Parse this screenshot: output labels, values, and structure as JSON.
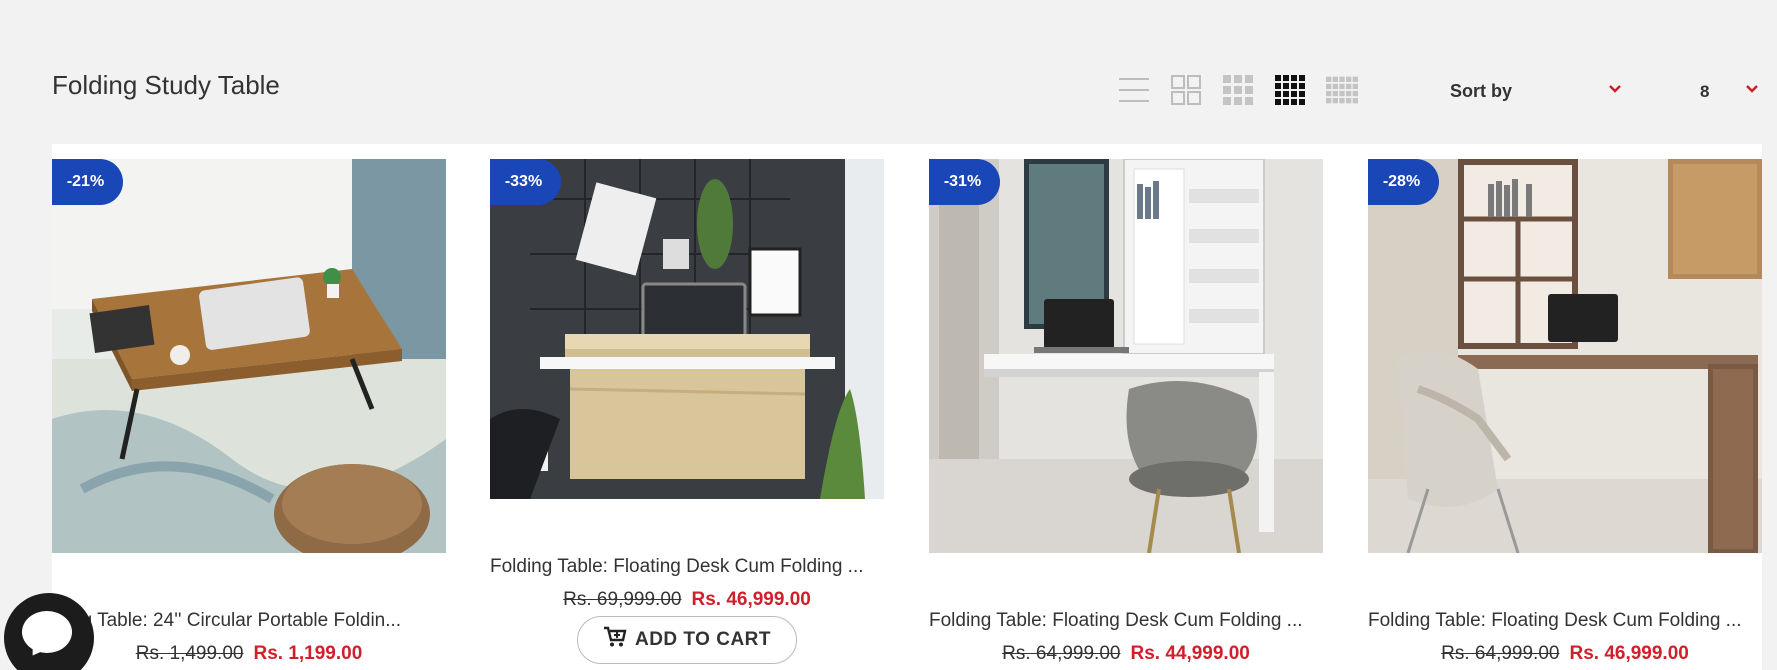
{
  "page": {
    "title": "Folding Study Table"
  },
  "toolbar": {
    "views": [
      "list-view-icon",
      "grid-2-icon",
      "grid-3-icon",
      "grid-4-icon",
      "grid-5-icon"
    ],
    "active_view": "grid-4-icon",
    "sort_label": "Sort by",
    "per_page": "8"
  },
  "colors": {
    "badge": "#1947b8",
    "price_new": "#d0202b",
    "accent": "#c8202a"
  },
  "products": [
    {
      "badge": "-21%",
      "title": "Folding Table: 24'' Circular Portable Folding Table",
      "title_display": "lding Table: 24'' Circular Portable Foldin...",
      "old_price": "Rs. 1,499.00",
      "new_price": "Rs. 1,199.00"
    },
    {
      "badge": "-33%",
      "title": "Folding Table: Floating Desk Cum Folding ...",
      "old_price": "Rs. 69,999.00",
      "new_price": "Rs. 46,999.00",
      "add_to_cart": "ADD TO CART"
    },
    {
      "badge": "-31%",
      "title": "Folding Table: Floating Desk Cum Folding ...",
      "old_price": "Rs. 64,999.00",
      "new_price": "Rs. 44,999.00"
    },
    {
      "badge": "-28%",
      "title": "Folding Table: Floating Desk Cum Folding ...",
      "old_price": "Rs. 64,999.00",
      "new_price": "Rs. 46,999.00"
    }
  ]
}
